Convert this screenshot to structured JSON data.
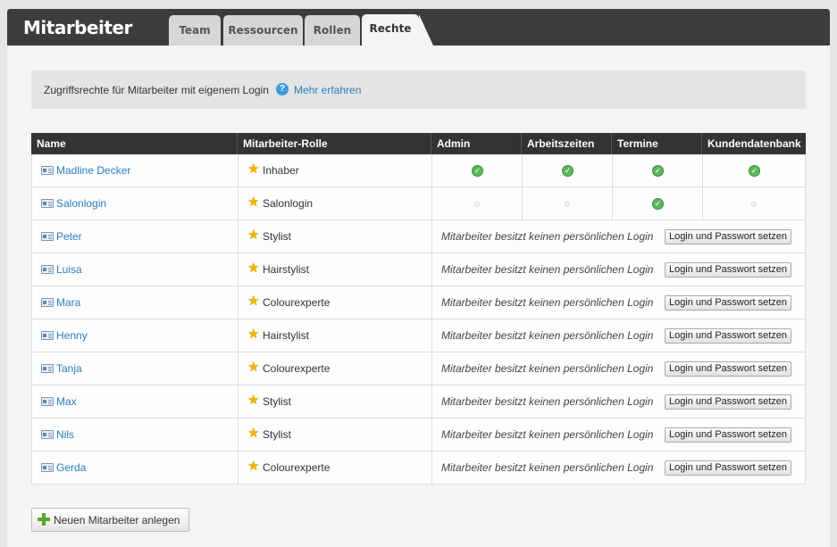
{
  "app": {
    "title": "Mitarbeiter"
  },
  "tabs": [
    {
      "label": "Team",
      "active": false
    },
    {
      "label": "Ressourcen",
      "active": false
    },
    {
      "label": "Rollen",
      "active": false
    },
    {
      "label": "Rechte",
      "active": true
    }
  ],
  "info": {
    "text": "Zugriffsrechte für Mitarbeiter mit eigenem Login",
    "link": "Mehr erfahren",
    "help_icon": "question-circle-icon"
  },
  "table": {
    "headers": [
      "Name",
      "Mitarbeiter-Rolle",
      "Admin",
      "Arbeitszeiten",
      "Termine",
      "Kundendatenbank"
    ],
    "no_login_text": "Mitarbeiter besitzt keinen persönlichen Login",
    "login_button": "Login und Passwort setzen",
    "rows": [
      {
        "name": "Madline Decker",
        "role": "Inhaber",
        "has_login": true,
        "perms": {
          "admin": true,
          "arbeitszeiten": true,
          "termine": true,
          "kundendatenbank": true
        }
      },
      {
        "name": "Salonlogin",
        "role": "Salonlogin",
        "has_login": true,
        "perms": {
          "admin": false,
          "arbeitszeiten": false,
          "termine": true,
          "kundendatenbank": false
        }
      },
      {
        "name": "Peter",
        "role": "Stylist",
        "has_login": false
      },
      {
        "name": "Luisa",
        "role": "Hairstylist",
        "has_login": false
      },
      {
        "name": "Mara",
        "role": "Colourexperte",
        "has_login": false
      },
      {
        "name": "Henny",
        "role": "Hairstylist",
        "has_login": false
      },
      {
        "name": "Tanja",
        "role": "Colourexperte",
        "has_login": false
      },
      {
        "name": "Max",
        "role": "Stylist",
        "has_login": false
      },
      {
        "name": "Nils",
        "role": "Stylist",
        "has_login": false
      },
      {
        "name": "Gerda",
        "role": "Colourexperte",
        "has_login": false
      }
    ]
  },
  "footer": {
    "add_button": "Neuen Mitarbeiter anlegen",
    "add_icon": "plus-icon"
  },
  "colors": {
    "topbar": "#3c3c3c",
    "link": "#2a7fc0",
    "check": "#5cb85c",
    "star": "#f0b400"
  }
}
